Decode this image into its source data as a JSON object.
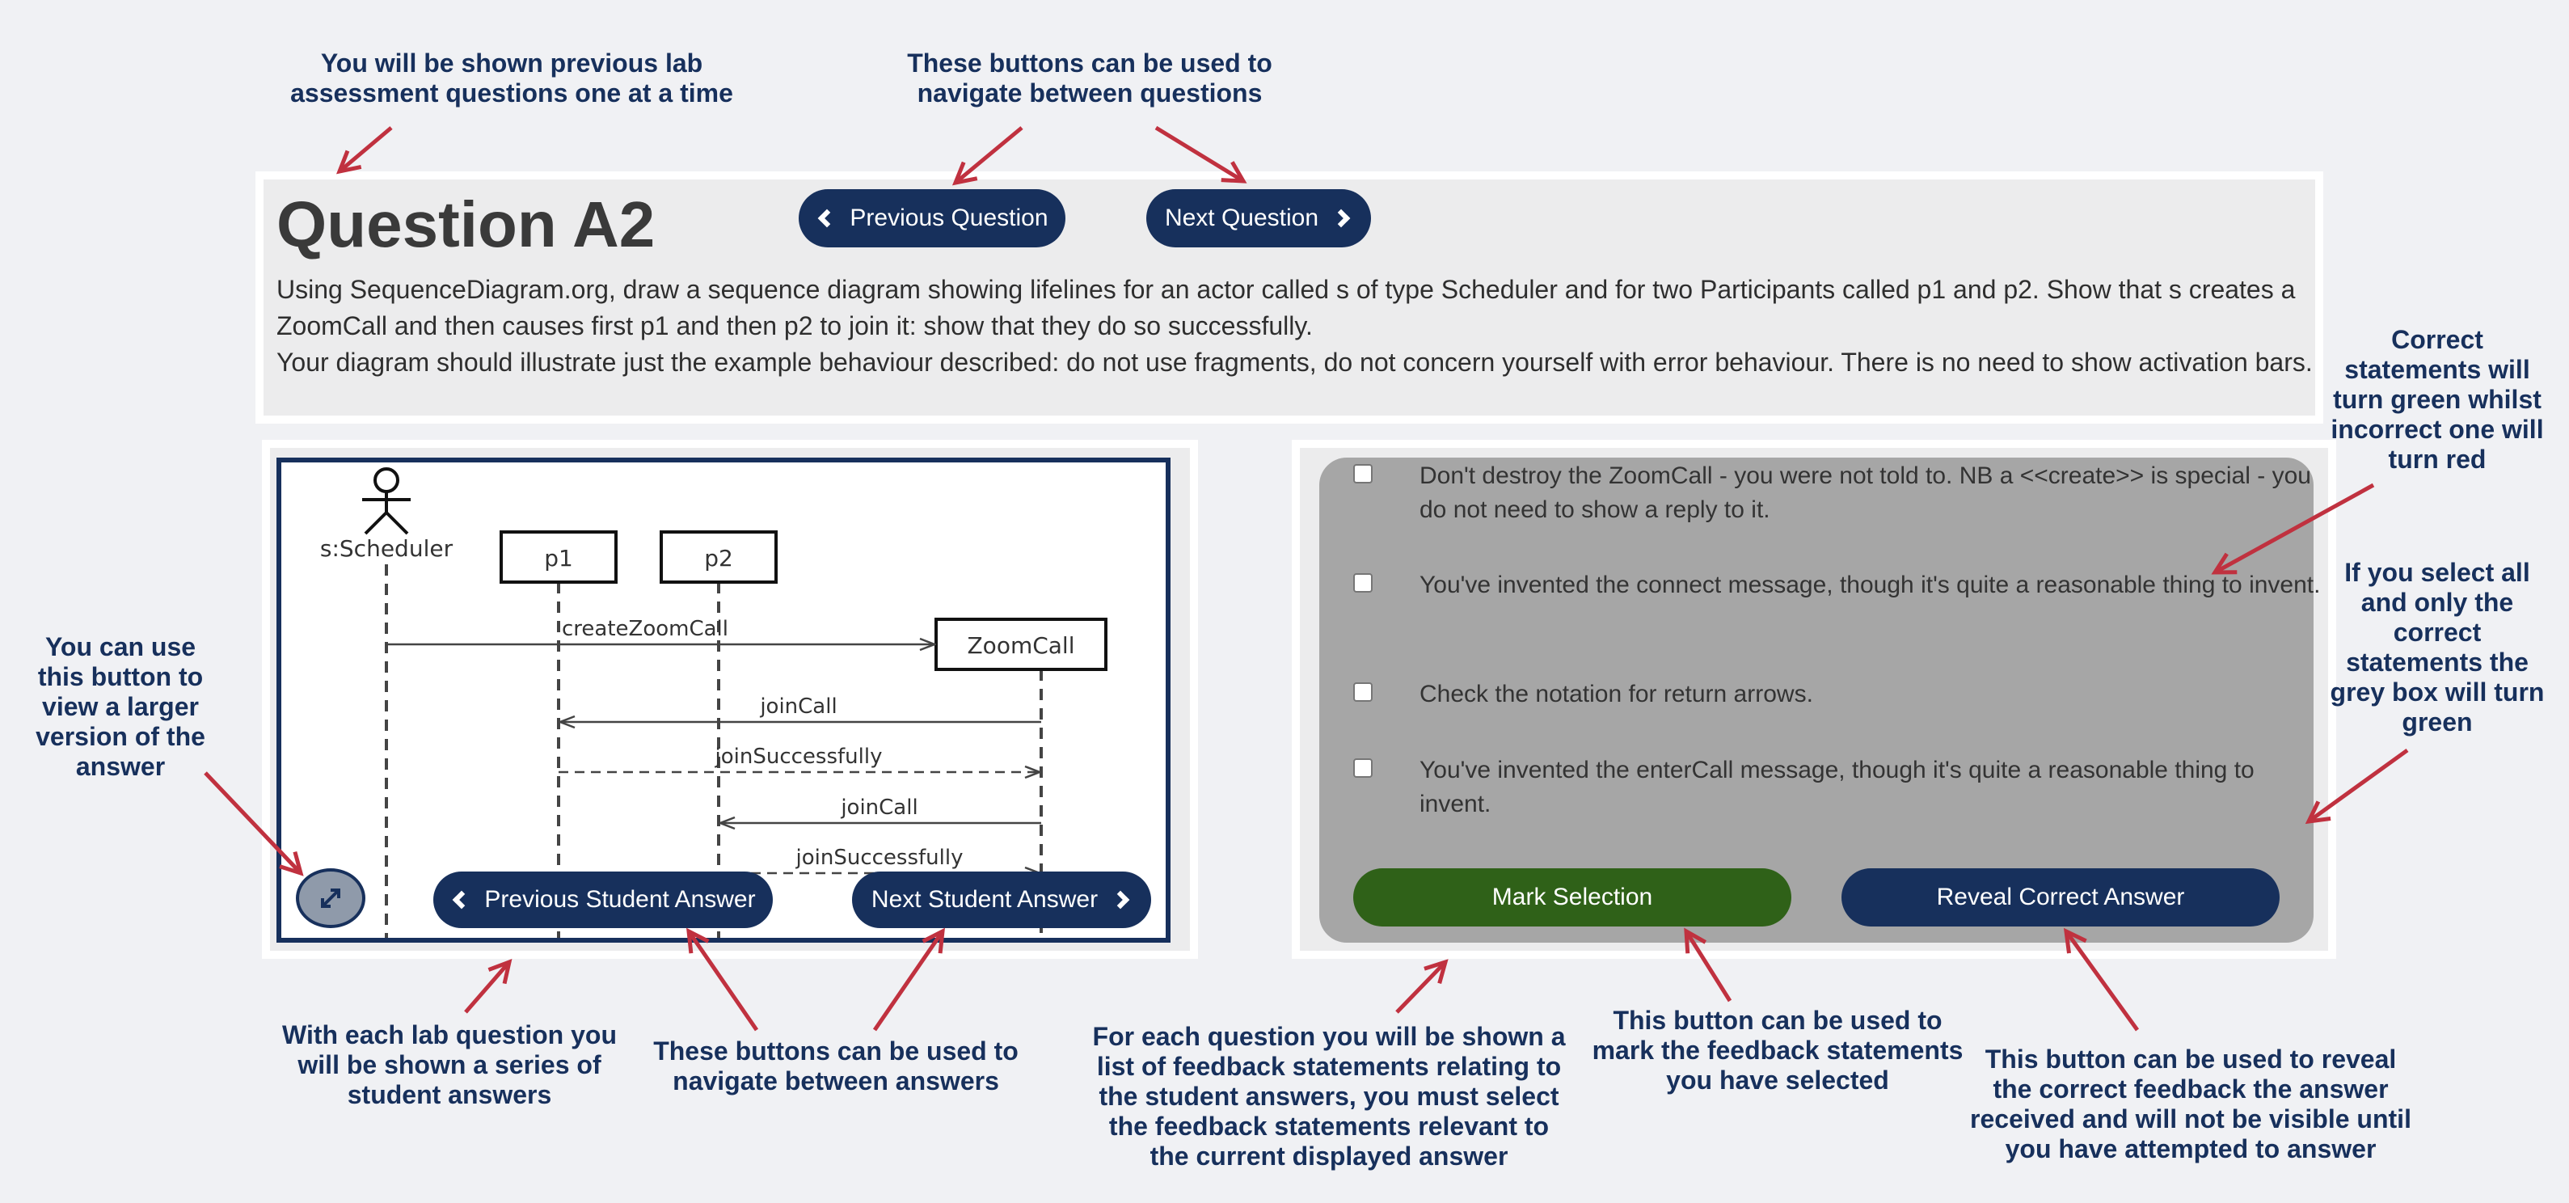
{
  "question": {
    "title": "Question A2",
    "text_line1": "Using SequenceDiagram.org, draw a sequence diagram showing lifelines for an actor called s of type Scheduler and for two Participants called p1 and p2. Show that s creates a ZoomCall and then causes first p1 and then p2 to join it: show that they do so successfully.",
    "text_line2": "Your diagram should illustrate just the example behaviour described: do not use fragments, do not concern yourself with error behaviour. There is no need to show activation bars.",
    "prev_label": "Previous Question",
    "next_label": "Next Question"
  },
  "diagram": {
    "actor": "s:Scheduler",
    "participants": [
      "p1",
      "p2"
    ],
    "created": "ZoomCall",
    "messages": [
      "createZoomCall",
      "joinCall",
      "joinSuccessfully",
      "joinCall",
      "joinSuccessfully"
    ]
  },
  "answer_nav": {
    "prev_label": "Previous Student Answer",
    "next_label": "Next Student Answer"
  },
  "feedback": {
    "items": [
      "Don't destroy the ZoomCall - you were not told to. NB a <<create>> is special - you do not need to show a reply to it.",
      "You've invented the connect message, though it's quite a reasonable thing to invent.",
      "Check the notation for return arrows.",
      "You've invented the enterCall message, though it's quite a reasonable thing to invent."
    ],
    "mark_label": "Mark Selection",
    "reveal_label": "Reveal Correct Answer"
  },
  "notes": {
    "questions_shown": "You will be shown previous lab assessment questions one at a time",
    "question_nav": "These buttons can be used to navigate between questions",
    "correct_green": "Correct statements will turn green whilst incorrect one will turn red",
    "grey_box": "If you select all and only the correct statements the grey box will turn green",
    "expand": "You can use this button to view a larger version of the answer",
    "student_answers": "With each lab question you will be shown a series of student answers",
    "answer_nav": "These buttons can be used to navigate between answers",
    "feedback_list": "For each question you will be shown a list of feedback statements relating to the student answers, you must select the feedback statements relevant to the current displayed answer",
    "mark": "This button can be used to mark the feedback statements you have selected",
    "reveal": "This button can be used to reveal the correct feedback the answer received and will not be visible until you have attempted to answer"
  },
  "colors": {
    "navy": "#17305c",
    "green": "#2f6118",
    "grey_box": "#a6a6a6",
    "arrow": "#c0313f"
  },
  "icons": [
    "chevron-left-icon",
    "chevron-right-icon",
    "expand-icon",
    "actor-icon",
    "annotation-arrow-icon"
  ]
}
